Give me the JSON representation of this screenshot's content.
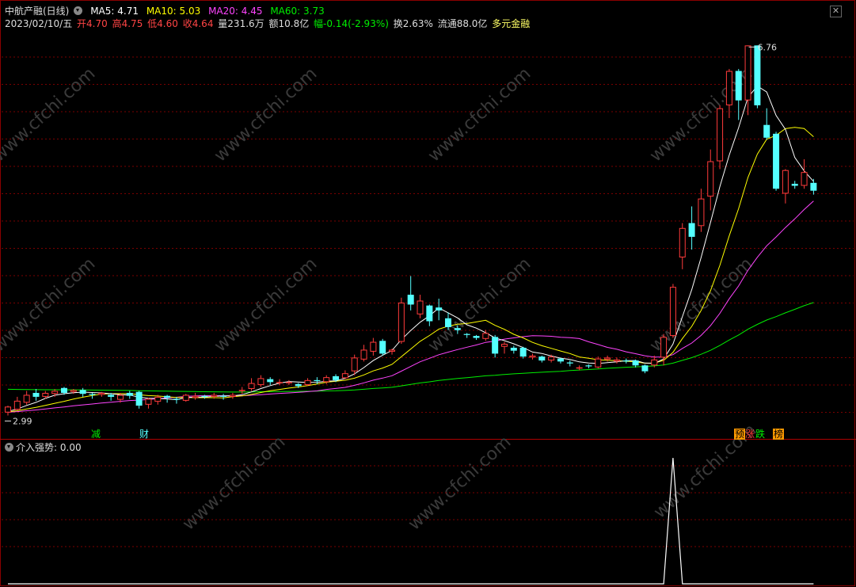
{
  "header": {
    "title": "中航产融(日线)",
    "ma5": "MA5: 4.71",
    "ma10": "MA10: 5.03",
    "ma20": "MA20: 4.45",
    "ma60": "MA60: 3.73",
    "date": "2023/02/10/五",
    "open": "开4.70",
    "high": "高4.75",
    "low": "低4.60",
    "close": "收4.64",
    "volume": "量231.6万",
    "amount": "额10.8亿",
    "change": "幅-0.14(-2.93%)",
    "turnover": "换2.63%",
    "float": "流通88.0亿",
    "sector": "多元金融"
  },
  "indicator": {
    "label": "介入强势",
    "value": ": 0.00"
  },
  "annotations": {
    "high_label": "6.76",
    "low_label": "2.99",
    "tags": [
      "减",
      "财",
      "预",
      "涨",
      "跌",
      "榜"
    ]
  },
  "watermark": "www.cfchi.com",
  "colors": {
    "up": "#ff3b3b",
    "down": "#54ffff",
    "ma5": "#ffffff",
    "ma10": "#ffff00",
    "ma20": "#ff44ff",
    "ma60": "#00ee00",
    "grid": "#7a0000"
  },
  "chart_data": {
    "type": "candlestick",
    "price_ylim": [
      2.8,
      6.9
    ],
    "candles": [
      {
        "o": 3.02,
        "c": 3.08,
        "h": 3.09,
        "l": 2.99
      },
      {
        "o": 3.05,
        "c": 3.14,
        "h": 3.18,
        "l": 3.04
      },
      {
        "o": 3.12,
        "c": 3.2,
        "h": 3.24,
        "l": 3.1
      },
      {
        "o": 3.22,
        "c": 3.18,
        "h": 3.26,
        "l": 3.14
      },
      {
        "o": 3.18,
        "c": 3.22,
        "h": 3.24,
        "l": 3.16
      },
      {
        "o": 3.21,
        "c": 3.24,
        "h": 3.26,
        "l": 3.18
      },
      {
        "o": 3.27,
        "c": 3.22,
        "h": 3.28,
        "l": 3.2
      },
      {
        "o": 3.23,
        "c": 3.25,
        "h": 3.26,
        "l": 3.21
      },
      {
        "o": 3.25,
        "c": 3.21,
        "h": 3.27,
        "l": 3.18
      },
      {
        "o": 3.21,
        "c": 3.2,
        "h": 3.22,
        "l": 3.16
      },
      {
        "o": 3.2,
        "c": 3.22,
        "h": 3.23,
        "l": 3.18
      },
      {
        "o": 3.2,
        "c": 3.18,
        "h": 3.22,
        "l": 3.14
      },
      {
        "o": 3.15,
        "c": 3.2,
        "h": 3.22,
        "l": 3.12
      },
      {
        "o": 3.22,
        "c": 3.19,
        "h": 3.24,
        "l": 3.16
      },
      {
        "o": 3.23,
        "c": 3.09,
        "h": 3.24,
        "l": 3.06
      },
      {
        "o": 3.1,
        "c": 3.16,
        "h": 3.17,
        "l": 3.06
      },
      {
        "o": 3.13,
        "c": 3.18,
        "h": 3.2,
        "l": 3.1
      },
      {
        "o": 3.19,
        "c": 3.17,
        "h": 3.2,
        "l": 3.12
      },
      {
        "o": 3.16,
        "c": 3.15,
        "h": 3.18,
        "l": 3.11
      },
      {
        "o": 3.14,
        "c": 3.2,
        "h": 3.21,
        "l": 3.13
      },
      {
        "o": 3.17,
        "c": 3.19,
        "h": 3.22,
        "l": 3.15
      },
      {
        "o": 3.19,
        "c": 3.18,
        "h": 3.2,
        "l": 3.16
      },
      {
        "o": 3.18,
        "c": 3.2,
        "h": 3.22,
        "l": 3.16
      },
      {
        "o": 3.19,
        "c": 3.18,
        "h": 3.21,
        "l": 3.15
      },
      {
        "o": 3.18,
        "c": 3.2,
        "h": 3.22,
        "l": 3.16
      },
      {
        "o": 3.24,
        "c": 3.25,
        "h": 3.28,
        "l": 3.21
      },
      {
        "o": 3.26,
        "c": 3.32,
        "h": 3.37,
        "l": 3.24
      },
      {
        "o": 3.3,
        "c": 3.37,
        "h": 3.4,
        "l": 3.28
      },
      {
        "o": 3.36,
        "c": 3.33,
        "h": 3.38,
        "l": 3.3
      },
      {
        "o": 3.33,
        "c": 3.33,
        "h": 3.36,
        "l": 3.3
      },
      {
        "o": 3.32,
        "c": 3.33,
        "h": 3.35,
        "l": 3.3
      },
      {
        "o": 3.31,
        "c": 3.29,
        "h": 3.32,
        "l": 3.27
      },
      {
        "o": 3.3,
        "c": 3.35,
        "h": 3.37,
        "l": 3.29
      },
      {
        "o": 3.35,
        "c": 3.34,
        "h": 3.38,
        "l": 3.31
      },
      {
        "o": 3.33,
        "c": 3.38,
        "h": 3.4,
        "l": 3.31
      },
      {
        "o": 3.39,
        "c": 3.35,
        "h": 3.41,
        "l": 3.33
      },
      {
        "o": 3.37,
        "c": 3.42,
        "h": 3.45,
        "l": 3.36
      },
      {
        "o": 3.44,
        "c": 3.58,
        "h": 3.61,
        "l": 3.4
      },
      {
        "o": 3.56,
        "c": 3.66,
        "h": 3.71,
        "l": 3.54
      },
      {
        "o": 3.64,
        "c": 3.74,
        "h": 3.78,
        "l": 3.6
      },
      {
        "o": 3.75,
        "c": 3.62,
        "h": 3.77,
        "l": 3.6
      },
      {
        "o": 3.64,
        "c": 3.66,
        "h": 3.67,
        "l": 3.61
      },
      {
        "o": 3.74,
        "c": 4.14,
        "h": 4.19,
        "l": 3.72
      },
      {
        "o": 4.22,
        "c": 4.12,
        "h": 4.41,
        "l": 4.06
      },
      {
        "o": 4.02,
        "c": 4.16,
        "h": 4.22,
        "l": 3.98
      },
      {
        "o": 4.11,
        "c": 3.95,
        "h": 4.12,
        "l": 3.9
      },
      {
        "o": 4.09,
        "c": 4.06,
        "h": 4.18,
        "l": 3.96
      },
      {
        "o": 3.98,
        "c": 3.89,
        "h": 4.04,
        "l": 3.86
      },
      {
        "o": 3.88,
        "c": 3.86,
        "h": 3.91,
        "l": 3.82
      },
      {
        "o": 3.82,
        "c": 3.81,
        "h": 3.83,
        "l": 3.78
      },
      {
        "o": 3.8,
        "c": 3.78,
        "h": 3.81,
        "l": 3.76
      },
      {
        "o": 3.77,
        "c": 3.83,
        "h": 3.86,
        "l": 3.75
      },
      {
        "o": 3.79,
        "c": 3.62,
        "h": 3.81,
        "l": 3.58
      },
      {
        "o": 3.69,
        "c": 3.72,
        "h": 3.74,
        "l": 3.62
      },
      {
        "o": 3.68,
        "c": 3.65,
        "h": 3.7,
        "l": 3.62
      },
      {
        "o": 3.68,
        "c": 3.59,
        "h": 3.69,
        "l": 3.57
      },
      {
        "o": 3.58,
        "c": 3.6,
        "h": 3.62,
        "l": 3.56
      },
      {
        "o": 3.59,
        "c": 3.55,
        "h": 3.6,
        "l": 3.53
      },
      {
        "o": 3.55,
        "c": 3.59,
        "h": 3.61,
        "l": 3.53
      },
      {
        "o": 3.57,
        "c": 3.54,
        "h": 3.58,
        "l": 3.52
      },
      {
        "o": 3.53,
        "c": 3.52,
        "h": 3.55,
        "l": 3.49
      },
      {
        "o": 3.48,
        "c": 3.48,
        "h": 3.5,
        "l": 3.45
      },
      {
        "o": 3.5,
        "c": 3.49,
        "h": 3.51,
        "l": 3.47
      },
      {
        "o": 3.48,
        "c": 3.57,
        "h": 3.59,
        "l": 3.47
      },
      {
        "o": 3.56,
        "c": 3.58,
        "h": 3.6,
        "l": 3.54
      },
      {
        "o": 3.54,
        "c": 3.56,
        "h": 3.58,
        "l": 3.52
      },
      {
        "o": 3.55,
        "c": 3.54,
        "h": 3.57,
        "l": 3.52
      },
      {
        "o": 3.55,
        "c": 3.5,
        "h": 3.56,
        "l": 3.48
      },
      {
        "o": 3.5,
        "c": 3.44,
        "h": 3.51,
        "l": 3.42
      },
      {
        "o": 3.5,
        "c": 3.56,
        "h": 3.6,
        "l": 3.48
      },
      {
        "o": 3.58,
        "c": 3.79,
        "h": 3.82,
        "l": 3.5
      },
      {
        "o": 3.8,
        "c": 4.3,
        "h": 4.33,
        "l": 3.78
      },
      {
        "o": 4.6,
        "c": 4.9,
        "h": 4.95,
        "l": 4.48
      },
      {
        "o": 4.95,
        "c": 4.81,
        "h": 5.12,
        "l": 4.68
      },
      {
        "o": 4.92,
        "c": 5.2,
        "h": 5.3,
        "l": 4.86
      },
      {
        "o": 5.22,
        "c": 5.58,
        "h": 5.7,
        "l": 5.08
      },
      {
        "o": 5.58,
        "c": 6.12,
        "h": 6.15,
        "l": 5.5
      },
      {
        "o": 6.15,
        "c": 6.5,
        "h": 6.52,
        "l": 6.02
      },
      {
        "o": 6.5,
        "c": 6.2,
        "h": 6.52,
        "l": 6.0
      },
      {
        "o": 6.2,
        "c": 6.76,
        "h": 6.76,
        "l": 6.05
      },
      {
        "o": 6.76,
        "c": 6.15,
        "h": 6.76,
        "l": 6.12
      },
      {
        "o": 5.95,
        "c": 5.82,
        "h": 6.12,
        "l": 5.8
      },
      {
        "o": 5.86,
        "c": 5.3,
        "h": 5.88,
        "l": 5.28
      },
      {
        "o": 5.25,
        "c": 5.49,
        "h": 5.5,
        "l": 5.15
      },
      {
        "o": 5.35,
        "c": 5.33,
        "h": 5.38,
        "l": 5.3
      },
      {
        "o": 5.33,
        "c": 5.47,
        "h": 5.6,
        "l": 5.3
      },
      {
        "o": 5.36,
        "c": 5.28,
        "h": 5.4,
        "l": 5.24
      }
    ],
    "indicator_ylim": [
      0,
      1
    ],
    "indicator_values": [
      0,
      0,
      0,
      0,
      0,
      0,
      0,
      0,
      0,
      0,
      0,
      0,
      0,
      0,
      0,
      0,
      0,
      0,
      0,
      0,
      0,
      0,
      0,
      0,
      0,
      0,
      0,
      0,
      0,
      0,
      0,
      0,
      0,
      0,
      0,
      0,
      0,
      0,
      0,
      0,
      0,
      0,
      0,
      0,
      0,
      0,
      0,
      0,
      0,
      0,
      0,
      0,
      0,
      0,
      0,
      0,
      0,
      0,
      0,
      0,
      0,
      0,
      0,
      0,
      0,
      0,
      0,
      0,
      0,
      0,
      0,
      1,
      0,
      0,
      0,
      0,
      0,
      0,
      0,
      0,
      0,
      0,
      0,
      0,
      0,
      0,
      0
    ]
  }
}
